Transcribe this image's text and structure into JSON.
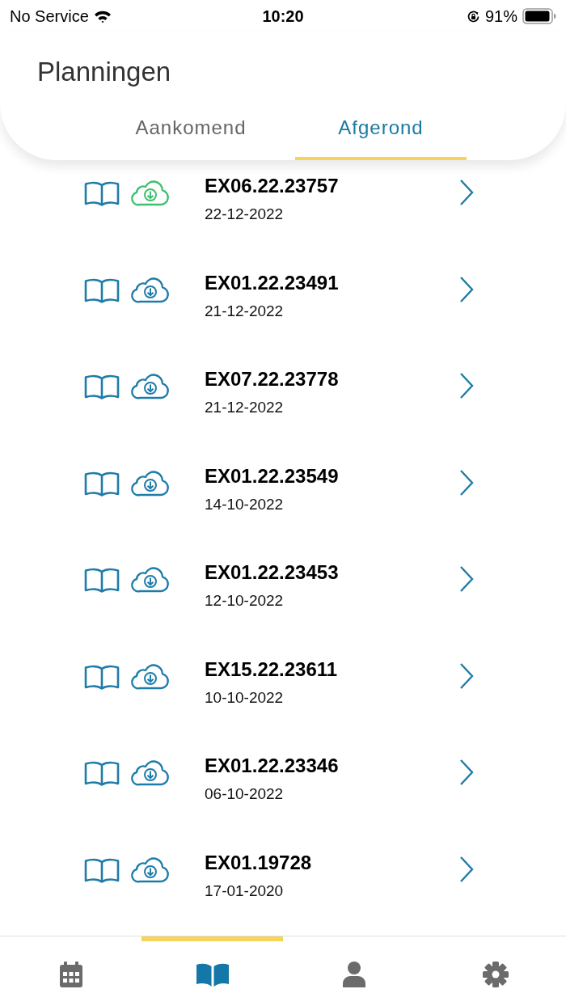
{
  "status_bar": {
    "carrier": "No Service",
    "time": "10:20",
    "battery": "91%"
  },
  "header": {
    "title": "Planningen"
  },
  "tabs": [
    {
      "label": "Aankomend",
      "selected": false
    },
    {
      "label": "Afgerond",
      "selected": true
    }
  ],
  "rows": [
    {
      "code": "EX06.22.23757",
      "date": "22-12-2022",
      "downloaded": true
    },
    {
      "code": "EX01.22.23491",
      "date": "21-12-2022",
      "downloaded": false
    },
    {
      "code": "EX07.22.23778",
      "date": "21-12-2022",
      "downloaded": false
    },
    {
      "code": "EX01.22.23549",
      "date": "14-10-2022",
      "downloaded": false
    },
    {
      "code": "EX01.22.23453",
      "date": "12-10-2022",
      "downloaded": false
    },
    {
      "code": "EX15.22.23611",
      "date": "10-10-2022",
      "downloaded": false
    },
    {
      "code": "EX01.22.23346",
      "date": "06-10-2022",
      "downloaded": false
    },
    {
      "code": "EX01.19728",
      "date": "17-01-2020",
      "downloaded": false
    }
  ],
  "nav": [
    {
      "kind": "calendar",
      "selected": false
    },
    {
      "kind": "book",
      "selected": true
    },
    {
      "kind": "person",
      "selected": false
    },
    {
      "kind": "settings",
      "selected": false
    }
  ]
}
